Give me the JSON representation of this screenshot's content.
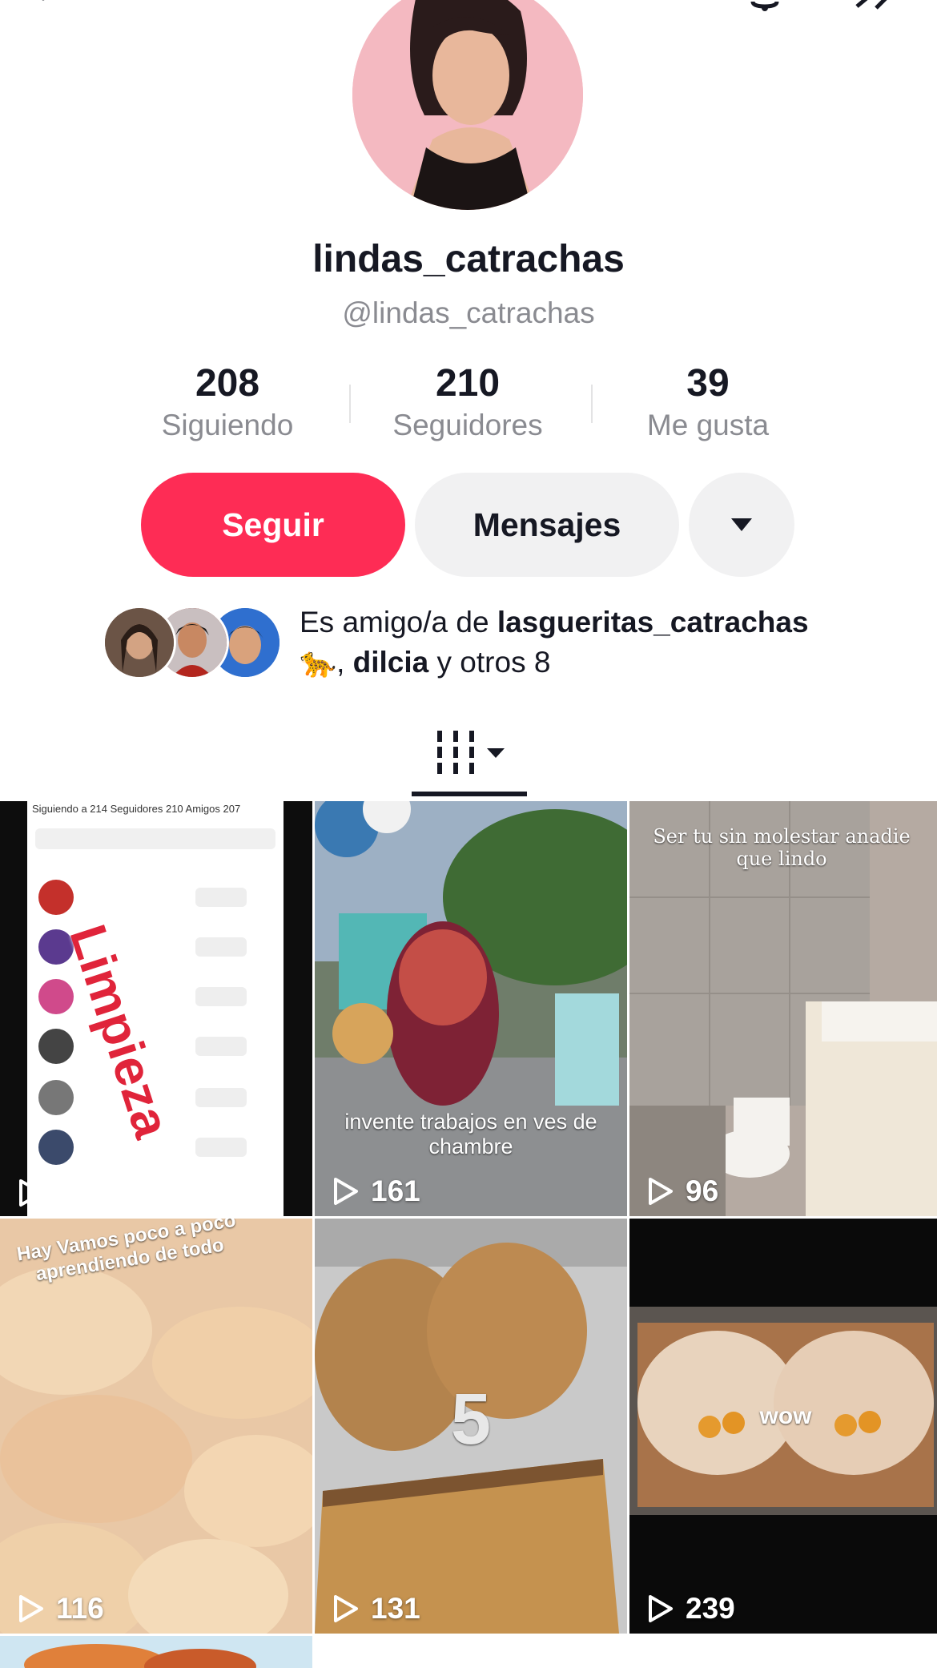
{
  "profile": {
    "display_name": "lindas_catrachas",
    "handle": "@lindas_catrachas"
  },
  "stats": {
    "following_count": "208",
    "following_label": "Siguiendo",
    "followers_count": "210",
    "followers_label": "Seguidores",
    "likes_count": "39",
    "likes_label": "Me gusta"
  },
  "actions": {
    "follow_label": "Seguir",
    "message_label": "Mensajes"
  },
  "friends": {
    "prefix": "Es amigo/a de ",
    "friend_1": "lasgueritas_catrachas",
    "emoji": "🐆",
    "separator": ", ",
    "friend_2": "dilcia",
    "suffix": " y otros 8"
  },
  "videos": [
    {
      "views": "",
      "overlay": "Limpieza",
      "sub_overlay": "Siguiendo a 214   Seguidores 210   Amigos 207"
    },
    {
      "views": "161",
      "overlay": "invente trabajos en ves de chambre"
    },
    {
      "views": "96",
      "overlay": "Ser tu sin molestar anadie que lindo"
    },
    {
      "views": "116",
      "overlay": "Hay Vamos poco a poco aprendiendo de todo"
    },
    {
      "views": "131",
      "overlay": "5"
    },
    {
      "views": "239",
      "overlay": "wow"
    }
  ],
  "colors": {
    "accent": "#fe2c55",
    "secondary_button": "#f1f1f2",
    "muted_text": "#8a8b91"
  }
}
